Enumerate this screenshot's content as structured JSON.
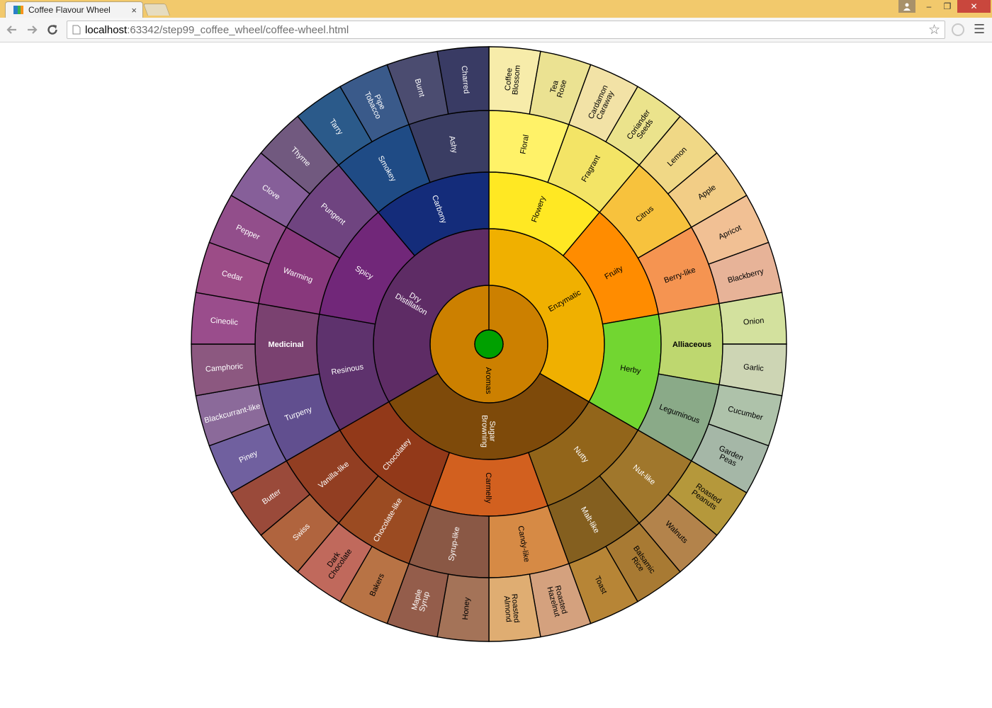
{
  "browser": {
    "tab_title": "Coffee Flavour Wheel",
    "tab_close": "×",
    "url_host": "localhost",
    "url_rest": ":63342/step99_coffee_wheel/coffee-wheel.html",
    "back_icon": "arrow-left-icon",
    "forward_icon": "arrow-right-icon",
    "reload_icon": "reload-icon",
    "star_icon": "star-icon",
    "menu_icon": "hamburger-menu-icon",
    "window_buttons": {
      "minimize": "–",
      "maximize": "❐",
      "close": "✕"
    }
  },
  "wheel": {
    "root_color": "#00a000",
    "rings": [
      {
        "name": "Aromas",
        "color": "#cc8000",
        "parent": null,
        "ring": 1,
        "start": 0,
        "end": 360,
        "text_color": "#000000"
      },
      {
        "name": "Enzymatic",
        "color": "#f0b000",
        "parent": "Aromas",
        "ring": 2,
        "start": 0,
        "end": 120,
        "text_color": "#000000"
      },
      {
        "name": "Sugar Browning",
        "color": "#7e4a0a",
        "parent": "Aromas",
        "ring": 2,
        "start": 120,
        "end": 240,
        "text_color": "#ffffff"
      },
      {
        "name": "Dry Distillation",
        "color": "#5e2c65",
        "parent": "Aromas",
        "ring": 2,
        "start": 240,
        "end": 360,
        "text_color": "#ffffff"
      },
      {
        "name": "Flowery",
        "color": "#ffe823",
        "ring": 3,
        "start": 0,
        "end": 40,
        "text_color": "#000000"
      },
      {
        "name": "Fruity",
        "color": "#ff8c00",
        "ring": 3,
        "start": 40,
        "end": 80,
        "text_color": "#000000"
      },
      {
        "name": "Herby",
        "color": "#72d631",
        "ring": 3,
        "start": 80,
        "end": 120,
        "text_color": "#000000"
      },
      {
        "name": "Nutty",
        "color": "#92651a",
        "ring": 3,
        "start": 120,
        "end": 160,
        "text_color": "#ffffff"
      },
      {
        "name": "Carmelly",
        "color": "#d2601f",
        "ring": 3,
        "start": 160,
        "end": 200,
        "text_color": "#000000"
      },
      {
        "name": "Chocolatey",
        "color": "#923919",
        "ring": 3,
        "start": 200,
        "end": 240,
        "text_color": "#ffffff"
      },
      {
        "name": "Resinous",
        "color": "#5e326d",
        "ring": 3,
        "start": 240,
        "end": 280,
        "text_color": "#ffffff"
      },
      {
        "name": "Spicy",
        "color": "#712779",
        "ring": 3,
        "start": 280,
        "end": 320,
        "text_color": "#ffffff"
      },
      {
        "name": "Carbony",
        "color": "#142c7a",
        "ring": 3,
        "start": 320,
        "end": 360,
        "text_color": "#ffffff"
      },
      {
        "name": "Floral",
        "color": "#fff268",
        "ring": 4,
        "start": 0,
        "end": 20,
        "text_color": "#000000"
      },
      {
        "name": "Fragrant",
        "color": "#f3e466",
        "ring": 4,
        "start": 20,
        "end": 40,
        "text_color": "#000000"
      },
      {
        "name": "Citrus",
        "color": "#f7c23d",
        "ring": 4,
        "start": 40,
        "end": 60,
        "text_color": "#000000"
      },
      {
        "name": "Berry-like",
        "color": "#f59451",
        "ring": 4,
        "start": 60,
        "end": 80,
        "text_color": "#000000"
      },
      {
        "name": "Alliaceous",
        "color": "#bed76f",
        "ring": 4,
        "start": 80,
        "end": 100,
        "text_color": "#000000"
      },
      {
        "name": "Leguminous",
        "color": "#8aaa88",
        "ring": 4,
        "start": 100,
        "end": 120,
        "text_color": "#000000"
      },
      {
        "name": "Nut-like",
        "color": "#a0772c",
        "ring": 4,
        "start": 120,
        "end": 140,
        "text_color": "#ffffff"
      },
      {
        "name": "Malt-like",
        "color": "#845f1f",
        "ring": 4,
        "start": 140,
        "end": 160,
        "text_color": "#ffffff"
      },
      {
        "name": "Candy-like",
        "color": "#d68a45",
        "ring": 4,
        "start": 160,
        "end": 180,
        "text_color": "#000000"
      },
      {
        "name": "Syrup-like",
        "color": "#8a5845",
        "ring": 4,
        "start": 180,
        "end": 200,
        "text_color": "#ffffff"
      },
      {
        "name": "Chocolate-like",
        "color": "#9b4b22",
        "ring": 4,
        "start": 200,
        "end": 220,
        "text_color": "#ffffff"
      },
      {
        "name": "Vanilla-like",
        "color": "#923e22",
        "ring": 4,
        "start": 220,
        "end": 240,
        "text_color": "#ffffff"
      },
      {
        "name": "Turpeny",
        "color": "#614f8f",
        "ring": 4,
        "start": 240,
        "end": 260,
        "text_color": "#ffffff"
      },
      {
        "name": "Medicinal",
        "color": "#7a4170",
        "ring": 4,
        "start": 260,
        "end": 280,
        "text_color": "#ffffff"
      },
      {
        "name": "Warming",
        "color": "#88387c",
        "ring": 4,
        "start": 280,
        "end": 300,
        "text_color": "#ffffff"
      },
      {
        "name": "Pungent",
        "color": "#6f4480",
        "ring": 4,
        "start": 300,
        "end": 320,
        "text_color": "#ffffff"
      },
      {
        "name": "Smokey",
        "color": "#1f4b85",
        "ring": 4,
        "start": 320,
        "end": 340,
        "text_color": "#ffffff"
      },
      {
        "name": "Ashy",
        "color": "#3a3d63",
        "ring": 4,
        "start": 340,
        "end": 360,
        "text_color": "#ffffff"
      },
      {
        "name": "Coffee Blossom",
        "color": "#f7ecaa",
        "ring": 5,
        "start": 0,
        "end": 10,
        "text_color": "#000000"
      },
      {
        "name": "Tea Rose",
        "color": "#ebe292",
        "ring": 5,
        "start": 10,
        "end": 20,
        "text_color": "#000000"
      },
      {
        "name": "Cardamon Caraway",
        "color": "#f2e2a6",
        "ring": 5,
        "start": 20,
        "end": 30,
        "text_color": "#000000"
      },
      {
        "name": "Coriander Seeds",
        "color": "#ebe38c",
        "ring": 5,
        "start": 30,
        "end": 40,
        "text_color": "#000000"
      },
      {
        "name": "Lemon",
        "color": "#f0d886",
        "ring": 5,
        "start": 40,
        "end": 50,
        "text_color": "#000000"
      },
      {
        "name": "Apple",
        "color": "#f2cd86",
        "ring": 5,
        "start": 50,
        "end": 60,
        "text_color": "#000000"
      },
      {
        "name": "Apricot",
        "color": "#f1c094",
        "ring": 5,
        "start": 60,
        "end": 70,
        "text_color": "#000000"
      },
      {
        "name": "Blackberry",
        "color": "#e7b398",
        "ring": 5,
        "start": 70,
        "end": 80,
        "text_color": "#000000"
      },
      {
        "name": "Onion",
        "color": "#d3e19e",
        "ring": 5,
        "start": 80,
        "end": 90,
        "text_color": "#000000"
      },
      {
        "name": "Garlic",
        "color": "#cdd5b4",
        "ring": 5,
        "start": 90,
        "end": 100,
        "text_color": "#000000"
      },
      {
        "name": "Cucumber",
        "color": "#aec2aa",
        "ring": 5,
        "start": 100,
        "end": 110,
        "text_color": "#000000"
      },
      {
        "name": "Garden Peas",
        "color": "#a5b7a7",
        "ring": 5,
        "start": 110,
        "end": 120,
        "text_color": "#000000"
      },
      {
        "name": "Roasted Peanuts",
        "color": "#b5983b",
        "ring": 5,
        "start": 120,
        "end": 130,
        "text_color": "#000000"
      },
      {
        "name": "Walnuts",
        "color": "#b3834b",
        "ring": 5,
        "start": 130,
        "end": 140,
        "text_color": "#000000"
      },
      {
        "name": "Balsamic Rice",
        "color": "#a87a33",
        "ring": 5,
        "start": 140,
        "end": 150,
        "text_color": "#000000"
      },
      {
        "name": "Toast",
        "color": "#b78536",
        "ring": 5,
        "start": 150,
        "end": 160,
        "text_color": "#000000"
      },
      {
        "name": "Roasted Hazelnut",
        "color": "#d4a17e",
        "ring": 5,
        "start": 160,
        "end": 170,
        "text_color": "#000000"
      },
      {
        "name": "Roasted Almond",
        "color": "#dfad72",
        "ring": 5,
        "start": 170,
        "end": 180,
        "text_color": "#000000"
      },
      {
        "name": "Honey",
        "color": "#a47358",
        "ring": 5,
        "start": 180,
        "end": 190,
        "text_color": "#000000"
      },
      {
        "name": "Maple Syrup",
        "color": "#945d4b",
        "ring": 5,
        "start": 190,
        "end": 200,
        "text_color": "#ffffff"
      },
      {
        "name": "Bakers",
        "color": "#b87345",
        "ring": 5,
        "start": 200,
        "end": 210,
        "text_color": "#000000"
      },
      {
        "name": "Dark Chocolate",
        "color": "#c0695c",
        "ring": 5,
        "start": 210,
        "end": 220,
        "text_color": "#000000"
      },
      {
        "name": "Swiss",
        "color": "#b0643e",
        "ring": 5,
        "start": 220,
        "end": 230,
        "text_color": "#ffffff"
      },
      {
        "name": "Butter",
        "color": "#9a4a3a",
        "ring": 5,
        "start": 230,
        "end": 240,
        "text_color": "#ffffff"
      },
      {
        "name": "Piney",
        "color": "#70609f",
        "ring": 5,
        "start": 240,
        "end": 250,
        "text_color": "#ffffff"
      },
      {
        "name": "Blackcurrant-like",
        "color": "#8b6a9a",
        "ring": 5,
        "start": 250,
        "end": 260,
        "text_color": "#ffffff"
      },
      {
        "name": "Camphoric",
        "color": "#8c5880",
        "ring": 5,
        "start": 260,
        "end": 270,
        "text_color": "#ffffff"
      },
      {
        "name": "Cineolic",
        "color": "#9a4d8c",
        "ring": 5,
        "start": 270,
        "end": 280,
        "text_color": "#ffffff"
      },
      {
        "name": "Cedar",
        "color": "#9c4c87",
        "ring": 5,
        "start": 280,
        "end": 290,
        "text_color": "#ffffff"
      },
      {
        "name": "Pepper",
        "color": "#924e8b",
        "ring": 5,
        "start": 290,
        "end": 300,
        "text_color": "#ffffff"
      },
      {
        "name": "Clove",
        "color": "#865f99",
        "ring": 5,
        "start": 300,
        "end": 310,
        "text_color": "#ffffff"
      },
      {
        "name": "Thyme",
        "color": "#71597f",
        "ring": 5,
        "start": 310,
        "end": 320,
        "text_color": "#ffffff"
      },
      {
        "name": "Tarry",
        "color": "#2b5a8a",
        "ring": 5,
        "start": 320,
        "end": 330,
        "text_color": "#ffffff"
      },
      {
        "name": "Pipe Tobacco",
        "color": "#3a5a8a",
        "ring": 5,
        "start": 330,
        "end": 340,
        "text_color": "#ffffff"
      },
      {
        "name": "Burnt",
        "color": "#4b4c70",
        "ring": 5,
        "start": 340,
        "end": 350,
        "text_color": "#ffffff"
      },
      {
        "name": "Charred",
        "color": "#393b64",
        "ring": 5,
        "start": 350,
        "end": 360,
        "text_color": "#ffffff"
      }
    ]
  }
}
